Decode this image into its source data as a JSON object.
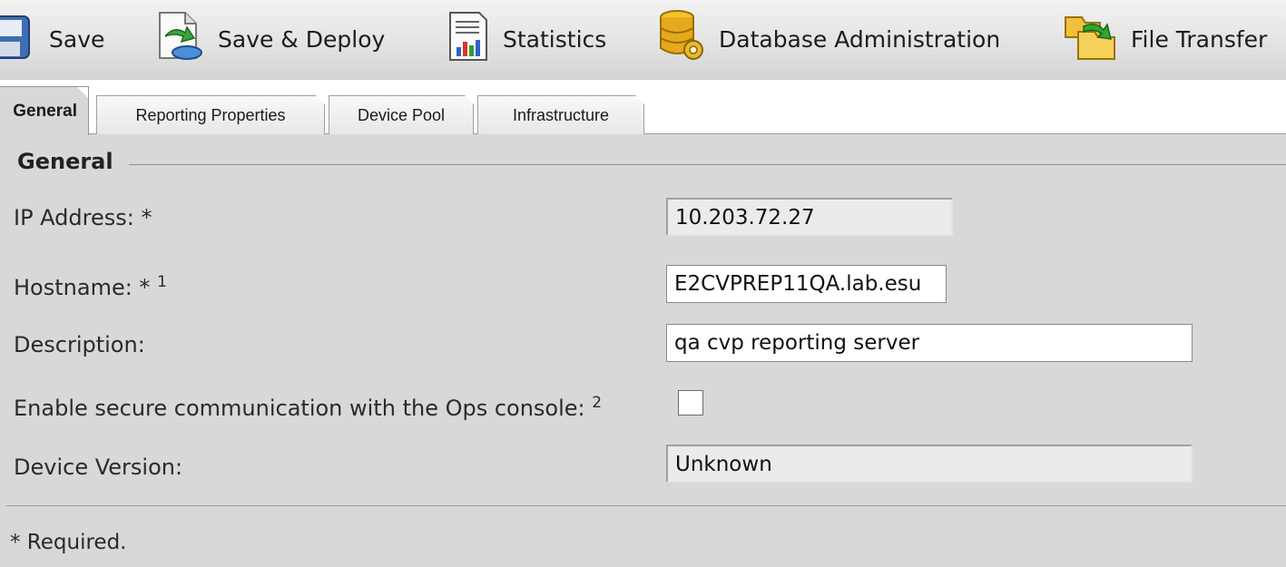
{
  "toolbar": {
    "items": [
      {
        "label": "Save",
        "icon": "save-icon"
      },
      {
        "label": "Save & Deploy",
        "icon": "save-deploy-icon"
      },
      {
        "label": "Statistics",
        "icon": "statistics-icon"
      },
      {
        "label": "Database Administration",
        "icon": "database-admin-icon"
      },
      {
        "label": "File Transfer",
        "icon": "file-transfer-icon"
      }
    ]
  },
  "tabs": [
    {
      "label": "General",
      "active": true
    },
    {
      "label": "Reporting Properties",
      "active": false
    },
    {
      "label": "Device Pool",
      "active": false
    },
    {
      "label": "Infrastructure",
      "active": false
    }
  ],
  "section": {
    "title": "General"
  },
  "form": {
    "ip": {
      "label": "IP Address: *",
      "value": "10.203.72.27"
    },
    "hostname": {
      "label": "Hostname: *",
      "footnote": "1",
      "value": "E2CVPREP11QA.lab.esu"
    },
    "description": {
      "label": "Description:",
      "value": "qa cvp reporting server"
    },
    "secure": {
      "label": "Enable secure communication with the Ops console:",
      "footnote": "2",
      "checked": false
    },
    "version": {
      "label": "Device Version:",
      "value": "Unknown"
    }
  },
  "footer": {
    "required_note": "* Required."
  },
  "colors": {
    "toolbar_bg": "#e3e3e3",
    "content_bg": "#d8d8d8",
    "tab_border": "#9aa1a8"
  }
}
